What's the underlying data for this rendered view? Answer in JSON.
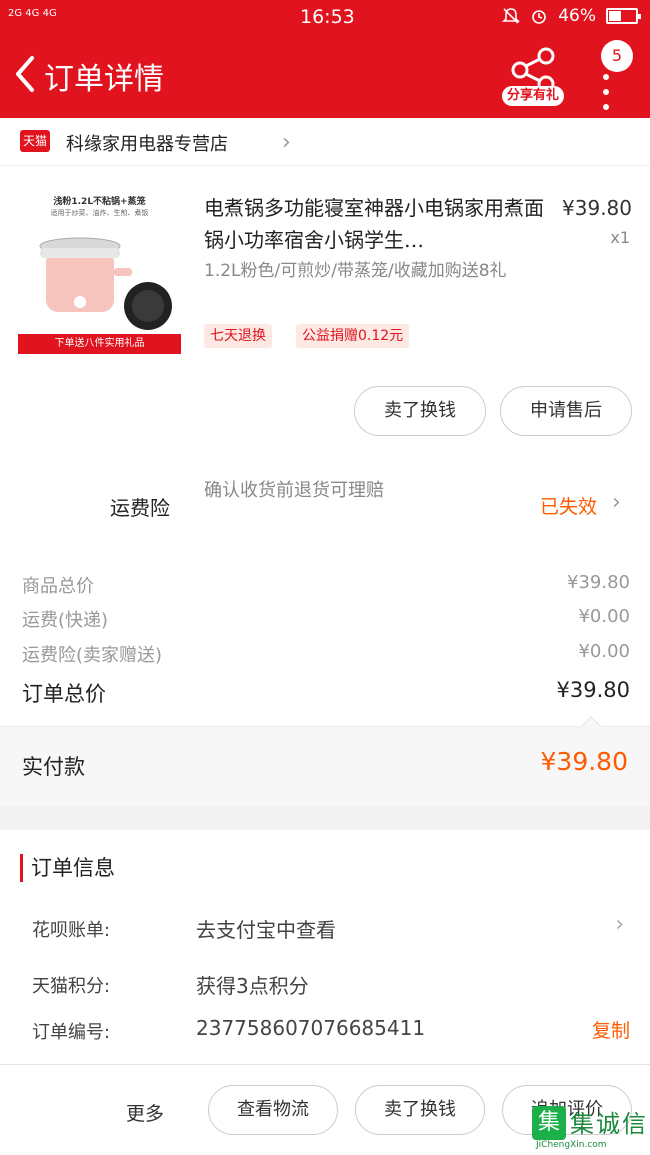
{
  "status_bar": {
    "signal": "2G 4G 4G",
    "time": "16:53",
    "battery": "46%",
    "battery_level": 0.46
  },
  "header": {
    "title": "订单详情",
    "share_label": "分享有礼",
    "badge_count": "5"
  },
  "shop": {
    "badge": "天猫",
    "name": "科缘家用电器专营店"
  },
  "product": {
    "image_text_top": "浅粉1.2L不粘锅+蒸笼",
    "image_text_sub": "适用于炒菜、油炸、生煎、煮饭",
    "image_banner": "下单送八件实用礼品",
    "title": "电煮锅多功能寝室神器小电锅家用煮面锅小功率宿舍小锅学生…",
    "price": "¥39.80",
    "quantity": "x1",
    "spec": "1.2L粉色/可煎炒/带蒸笼/收藏加购送8礼",
    "tags": [
      "七天退换",
      "公益捐赠0.12元"
    ],
    "buttons": [
      "卖了换钱",
      "申请售后"
    ]
  },
  "insurance": {
    "label": "运费险",
    "description": "确认收货前退货可理赔",
    "status": "已失效"
  },
  "prices": {
    "rows": [
      {
        "label": "商品总价",
        "value": "¥39.80"
      },
      {
        "label": "运费(快递)",
        "value": "¥0.00"
      },
      {
        "label": "运费险(卖家赠送)",
        "value": "¥0.00"
      }
    ],
    "total_label": "订单总价",
    "total_value": "¥39.80",
    "paid_label": "实付款",
    "paid_value": "¥39.80"
  },
  "order_info": {
    "heading": "订单信息",
    "huabei_label": "花呗账单:",
    "huabei_value": "去支付宝中查看",
    "points_label": "天猫积分:",
    "points_value": "获得3点积分",
    "order_no_label": "订单编号:",
    "order_no_value": "2377586070766854​11",
    "copy_label": "复制"
  },
  "bottom_bar": {
    "more_label": "更多",
    "buttons": [
      "查看物流",
      "卖了换钱",
      "追加评价"
    ]
  },
  "watermark": {
    "cn": "集诚信",
    "en": "JiChengXin.com"
  },
  "colors": {
    "brand_red": "#e1131e",
    "accent_orange": "#ff5a00"
  }
}
